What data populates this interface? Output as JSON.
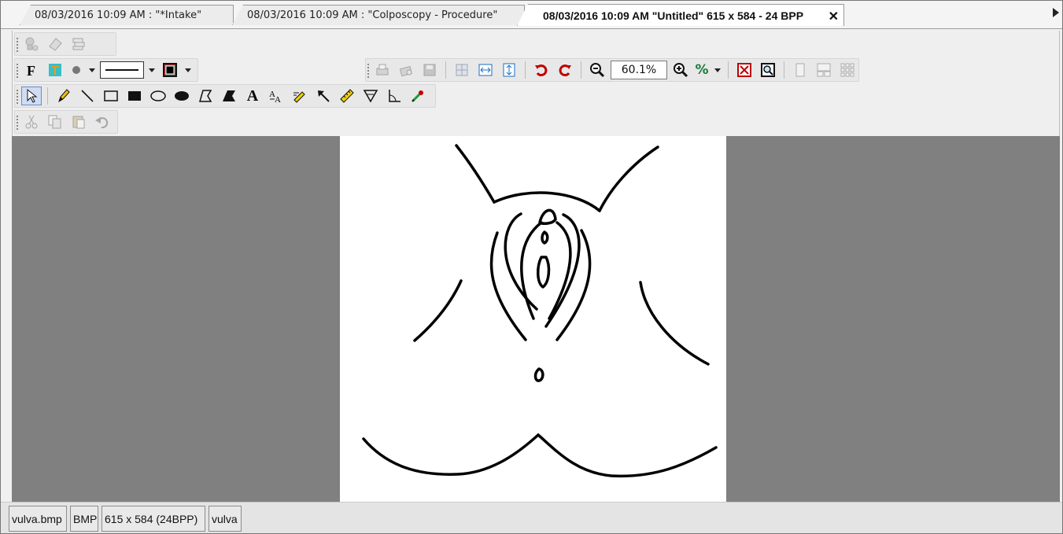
{
  "tabs": [
    {
      "label": "08/03/2016 10:09 AM : \"*Intake\""
    },
    {
      "label": "08/03/2016 10:09 AM : \"Colposcopy - Procedure\""
    },
    {
      "label": "08/03/2016 10:09 AM \"Untitled\" 615 x 584 - 24 BPP",
      "active": true
    }
  ],
  "toolbar": {
    "zoom_value": "60.1%",
    "percent_label": "%",
    "text_tool": "A"
  },
  "icons": {
    "row1": [
      "stamp-icon",
      "eraser-icon",
      "layers-icon"
    ],
    "format": [
      "bold-font-icon",
      "text-color-icon",
      "brush-size-icon",
      "line-style-icon",
      "color-picker-icon"
    ],
    "view": [
      "print-icon",
      "print-preview-icon",
      "save-icon",
      "fit-grid-icon",
      "fit-width-icon",
      "fit-height-icon",
      "rotate-left-icon",
      "rotate-right-icon",
      "zoom-out-icon",
      "zoom-in-icon",
      "percent-icon",
      "fit-window-icon",
      "actual-size-icon",
      "single-view-icon",
      "dual-view-icon",
      "grid-view-icon"
    ],
    "draw": [
      "select-icon",
      "pencil-icon",
      "line-icon",
      "rectangle-icon",
      "filled-rectangle-icon",
      "ellipse-icon",
      "filled-ellipse-icon",
      "polygon-icon",
      "filled-polygon-icon",
      "text-icon",
      "text-resize-icon",
      "highlight-icon",
      "arrow-icon",
      "ruler-icon",
      "angle-icon",
      "protractor-icon",
      "color-pick-icon"
    ],
    "edit": [
      "cut-icon",
      "copy-icon",
      "paste-icon",
      "undo-icon"
    ]
  },
  "status": {
    "filename": "vulva.bmp",
    "format": "BMP",
    "dimensions": "615 x 584 (24BPP)",
    "name": "vulva"
  },
  "colors": {
    "canvas_bg": "#808080",
    "image_bg": "#ffffff",
    "stroke": "#000000",
    "accent_red": "#c00000",
    "accent_blue": "#1a6fc4"
  }
}
